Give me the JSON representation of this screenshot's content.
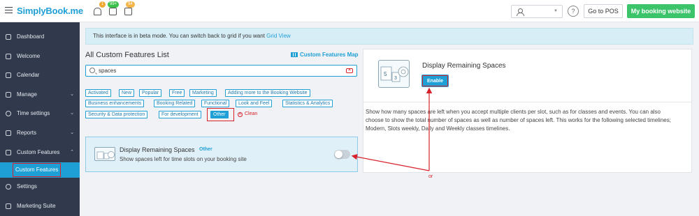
{
  "topbar": {
    "logo": "SimplyBook.me",
    "badges": [
      "1",
      "99+",
      "94"
    ],
    "go_to_pos": "Go to POS",
    "my_booking_website": "My booking website",
    "help": "?"
  },
  "sidebar": {
    "items": [
      {
        "label": "Dashboard",
        "icon": "dashboard-icon"
      },
      {
        "label": "Welcome",
        "icon": "bulb-icon"
      },
      {
        "label": "Calendar",
        "icon": "calendar-icon"
      },
      {
        "label": "Manage",
        "icon": "pencil-icon"
      },
      {
        "label": "Time settings",
        "icon": "clock-icon"
      },
      {
        "label": "Reports",
        "icon": "chart-icon"
      },
      {
        "label": "Custom Features",
        "icon": "puzzle-icon"
      },
      {
        "label": "Settings",
        "icon": "gear-icon"
      },
      {
        "label": "Marketing Suite",
        "icon": "megaphone-icon"
      }
    ],
    "active_sub": "Custom Features"
  },
  "beta": {
    "text": "This interface is in beta mode. You can switch back to grid if you want",
    "link": "Grid View"
  },
  "list": {
    "title": "All Custom Features List",
    "map_link": "Custom Features Map",
    "search_value": "spaces"
  },
  "tags": [
    "Activated",
    "New",
    "Popular",
    "Free",
    "Marketing",
    "Adding more to the Booking Website",
    "Business enhancements",
    "Booking Related",
    "Functional",
    "Look and Feel",
    "Statistics & Analytics",
    "Security & Data protection",
    "For development",
    "Other"
  ],
  "clean_label": "Clean",
  "feature": {
    "name": "Display Remaining Spaces",
    "category": "Other",
    "description": "Show spaces left for time slots on your booking site",
    "enabled": false
  },
  "detail": {
    "title": "Display Remaining Spaces",
    "enable_label": "Enable",
    "description": "Show how many spaces are left when you accept multiple clients per slot, such as for classes and events. You can also choose to show the total number of spaces as well as number of spaces left. This works for the following selected timelines; Modern, Slots weekly, Daily and Weekly classes timelines."
  },
  "annotation": {
    "or_label": "or",
    "color": "#d8202a"
  }
}
